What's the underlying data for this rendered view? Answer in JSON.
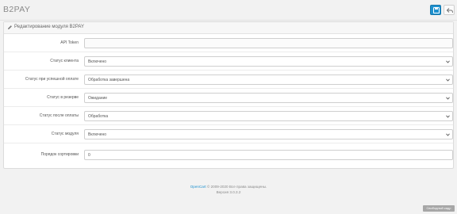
{
  "header": {
    "title": "B2PAY",
    "save_label": "Save",
    "back_label": "Cancel"
  },
  "panel": {
    "title": "Редактирование модуля B2PAY"
  },
  "form": {
    "rows": [
      {
        "label": "API Token",
        "value": ""
      },
      {
        "label": "Статус клиента",
        "value": "Включено"
      },
      {
        "label": "Статус при успешной оплате",
        "value": "Обработка завершена"
      },
      {
        "label": "Статус в резерве",
        "value": "Ожидание"
      },
      {
        "label": "Статус после оплаты",
        "value": "Обработка"
      },
      {
        "label": "Статус модуля",
        "value": "Включено"
      },
      {
        "label": "Порядок сортировки",
        "value": "0"
      }
    ]
  },
  "footer": {
    "brand_link": "OpenCart",
    "copyright": "© 2009-2020 Все права защищены.",
    "version": "Версия 3.0.3.2"
  },
  "watermark": "Свободный кадр",
  "colors": {
    "primary": "#1e91cf",
    "background": "#f2f2f2"
  }
}
